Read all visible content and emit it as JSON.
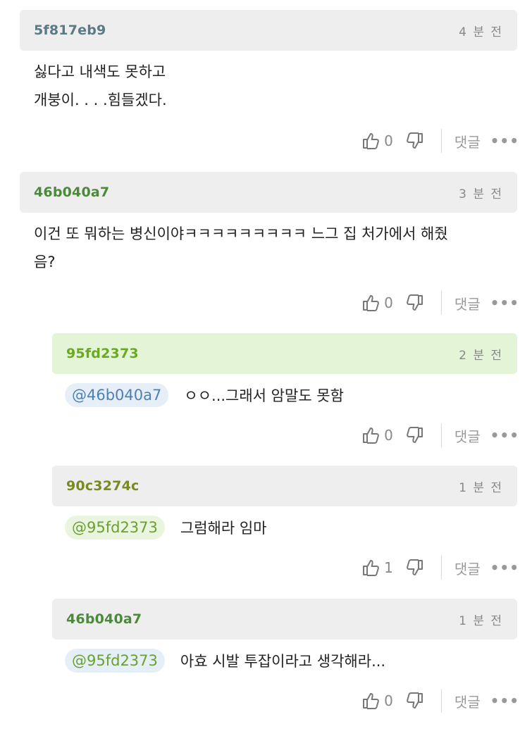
{
  "comments": [
    {
      "user": "5f817eb9",
      "user_color": "#5a7a85",
      "time": "4 분 전",
      "header_bg": "#eeeeee",
      "lines": [
        "싫다고 내색도 못하고",
        "개붕이. . . .힘들겠다."
      ],
      "likes": "0",
      "reply_label": "댓글",
      "more_label": "•••"
    },
    {
      "user": "46b040a7",
      "user_color": "#4b8a3a",
      "time": "3 분 전",
      "header_bg": "#eeeeee",
      "lines": [
        "이건 또 뭐하는 병신이야ㅋㅋㅋㅋㅋㅋㅋㅋㅋ 느그 집 처가에서 해줬",
        "음?"
      ],
      "likes": "0",
      "reply_label": "댓글",
      "more_label": "•••"
    }
  ],
  "replies": [
    {
      "user": "95fd2373",
      "user_color": "#6aaa1f",
      "time": "2 분 전",
      "header_bg": "#e4f4d6",
      "mention": "@46b040a7",
      "mention_color": "#4f7fb5",
      "mention_bg": "#e6eff8",
      "text": "ㅇㅇ...그래서 암말도 못함",
      "likes": "0",
      "reply_label": "댓글",
      "more_label": "•••"
    },
    {
      "user": "90c3274c",
      "user_color": "#7a8a20",
      "time": "1 분 전",
      "header_bg": "#eeeeee",
      "mention": "@95fd2373",
      "mention_color": "#6aa030",
      "mention_bg": "#eaf5e0",
      "text": "그럼해라 임마",
      "likes": "1",
      "reply_label": "댓글",
      "more_label": "•••"
    },
    {
      "user": "46b040a7",
      "user_color": "#4b8a3a",
      "time": "1 분 전",
      "header_bg": "#eeeeee",
      "mention": "@95fd2373",
      "mention_color": "#6aa030",
      "mention_bg": "#e6eff8",
      "text": "아효 시발 투잡이라고 생각해라...",
      "likes": "0",
      "reply_label": "댓글",
      "more_label": "•••"
    }
  ]
}
